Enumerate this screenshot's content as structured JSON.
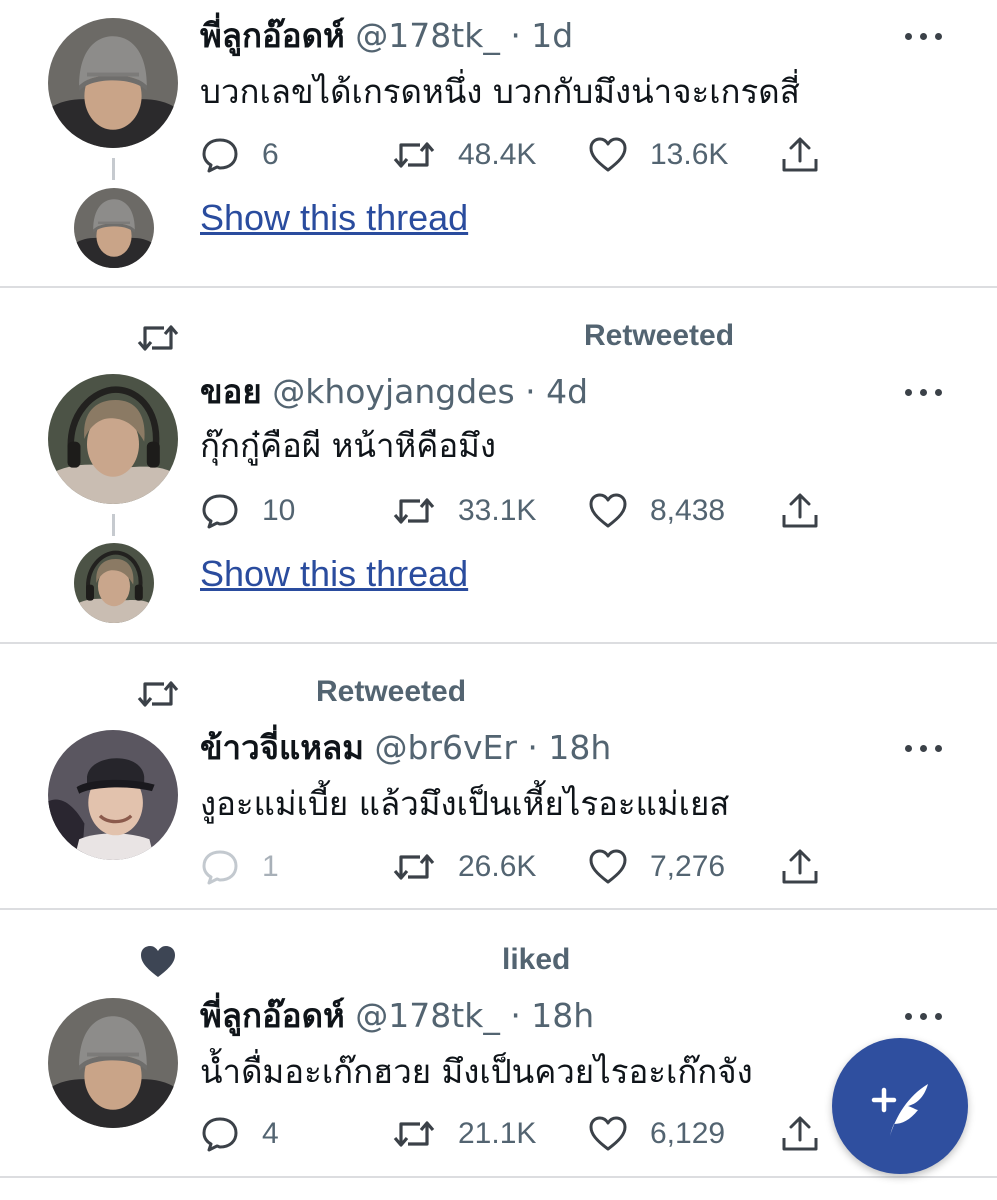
{
  "tweets": [
    {
      "name": "พี่ลูกอ๊อดห์",
      "handle": "@178tk_",
      "time": "· 1d",
      "text": "บวกเลขได้เกรดหนึ่ง บวกกับมึงน่าจะเกรดสี่",
      "replies": "6",
      "retweets": "48.4K",
      "likes": "13.6K",
      "show_thread": "Show this thread"
    },
    {
      "context": "Retweeted",
      "name": "ขอย",
      "handle": "@khoyjangdes",
      "time": "· 4d",
      "text": "กุ๊กกู๋คือผี หน้าหีคือมึง",
      "replies": "10",
      "retweets": "33.1K",
      "likes": "8,438",
      "show_thread": "Show this thread"
    },
    {
      "context": "Retweeted",
      "name": "ข้าวจี่แหลม",
      "handle": "@br6vEr",
      "time": "· 18h",
      "text": "งูอะแม่เบี้ย แล้วมึงเป็นเหี้ยไรอะแม่เยส",
      "replies": "1",
      "retweets": "26.6K",
      "likes": "7,276"
    },
    {
      "context": "liked",
      "name": "พี่ลูกอ๊อดห์",
      "handle": "@178tk_",
      "time": "· 18h",
      "text": "น้ำดื่มอะเก๊กฮวย มึงเป็นควยไรอะเก๊กจัง",
      "replies": "4",
      "retweets": "21.1K",
      "likes": "6,129"
    }
  ],
  "icons": {
    "reply": "reply-icon",
    "retweet": "retweet-icon",
    "like": "heart-icon",
    "share": "share-icon",
    "more": "more-icon",
    "compose": "compose-tweet-icon"
  },
  "colors": {
    "link": "#2a4c9e",
    "secondary_text": "#536471",
    "fab": "#2f4f9f"
  }
}
